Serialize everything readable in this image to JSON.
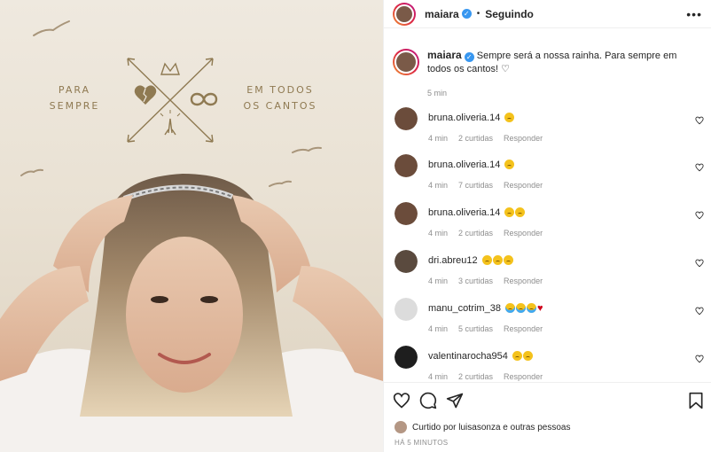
{
  "media": {
    "left_text_1": "PARA",
    "left_text_2": "SEMPRE",
    "right_text_1": "EM TODOS",
    "right_text_2": "OS CANTOS"
  },
  "header": {
    "username": "maiara",
    "verified_icon": "verified-badge-icon",
    "separator": "•",
    "follow_status": "Seguindo",
    "more_label": "•••"
  },
  "caption": {
    "username": "maiara",
    "text": "Sempre será a nossa rainha. Para sempre em todos os cantos! ♡",
    "time": "5 min"
  },
  "comments": [
    {
      "username": "bruna.oliveria.14",
      "emojis": [
        "sad"
      ],
      "time": "4 min",
      "likes": "2 curtidas",
      "reply": "Responder",
      "avatar_color": "#6b4c3b"
    },
    {
      "username": "bruna.oliveria.14",
      "emojis": [
        "sad"
      ],
      "time": "4 min",
      "likes": "7 curtidas",
      "reply": "Responder",
      "avatar_color": "#6b4c3b"
    },
    {
      "username": "bruna.oliveria.14",
      "emojis": [
        "sad",
        "sad"
      ],
      "time": "4 min",
      "likes": "2 curtidas",
      "reply": "Responder",
      "avatar_color": "#6b4c3b"
    },
    {
      "username": "dri.abreu12",
      "emojis": [
        "sad",
        "sad",
        "sad"
      ],
      "time": "4 min",
      "likes": "3 curtidas",
      "reply": "Responder",
      "avatar_color": "#5a4a3e"
    },
    {
      "username": "manu_cotrim_38",
      "emojis": [
        "cry",
        "cry",
        "cry",
        "heart"
      ],
      "time": "4 min",
      "likes": "5 curtidas",
      "reply": "Responder",
      "avatar_color": "#dcdcdc"
    },
    {
      "username": "valentinarocha954",
      "emojis": [
        "sad",
        "sad"
      ],
      "time": "4 min",
      "likes": "2 curtidas",
      "reply": "Responder",
      "avatar_color": "#1e1e1e"
    }
  ],
  "actions": {
    "like_icon": "heart-outline-icon",
    "comment_icon": "comment-bubble-icon",
    "share_icon": "paper-plane-icon",
    "save_icon": "bookmark-icon"
  },
  "liked_by": {
    "prefix": "Curtido por ",
    "user": "luisasonza",
    "suffix": " e outras pessoas"
  },
  "timestamp": "HÁ 5 MINUTOS",
  "colors": {
    "accent": "#3897f0",
    "text": "#262626",
    "muted": "#8e8e8e",
    "emblem_gold": "#8f7a52"
  }
}
